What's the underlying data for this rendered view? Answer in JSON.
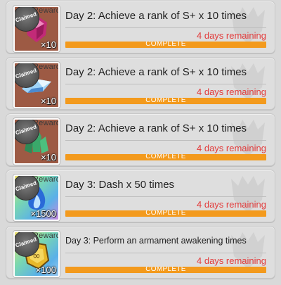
{
  "missions": [
    {
      "title": "Day 2: Achieve a rank of S+  x 10 times",
      "reward_label": "Reward",
      "claimed": "Claimed",
      "quantity": "×10",
      "remaining": "4 days remaining",
      "status": "COMPLETE",
      "progress": 1.0,
      "icon": "pink-gem-icon",
      "thumb_bg": "#8a4a3a",
      "accent": "#d63a8a"
    },
    {
      "title": "Day 2: Achieve a rank of S+  x 10 times",
      "reward_label": "Reward",
      "claimed": "Claimed",
      "quantity": "×10",
      "remaining": "4 days remaining",
      "status": "COMPLETE",
      "progress": 1.0,
      "icon": "blue-crystal-icon",
      "thumb_bg": "#8a4a3a",
      "accent": "#5aa8e8"
    },
    {
      "title": "Day 2: Achieve a rank of S+  x 10 times",
      "reward_label": "Reward",
      "claimed": "Claimed",
      "quantity": "×10",
      "remaining": "4 days remaining",
      "status": "COMPLETE",
      "progress": 1.0,
      "icon": "green-crystal-icon",
      "thumb_bg": "#8a4a3a",
      "accent": "#3aa86a"
    },
    {
      "title": "Day 3: Dash  x 50 times",
      "reward_label": "Reward",
      "claimed": "Claimed",
      "quantity": "×1500",
      "remaining": "4 days remaining",
      "status": "COMPLETE",
      "progress": 1.0,
      "icon": "blue-flame-icon",
      "thumb_bg": "#4aa3c8",
      "accent": "#2a6ad8"
    },
    {
      "title": "Day 3: Perform an armament awakening  times",
      "reward_label": "Reward",
      "claimed": "Claimed",
      "quantity": "×100",
      "remaining": "4 days remaining",
      "status": "COMPLETE",
      "progress": 1.0,
      "icon": "gold-badge-icon",
      "thumb_bg": "#4aa3c8",
      "accent": "#e8b82a"
    }
  ],
  "colors": {
    "progress_fill": "#f39a1d",
    "remaining_text": "#e23c3c"
  }
}
